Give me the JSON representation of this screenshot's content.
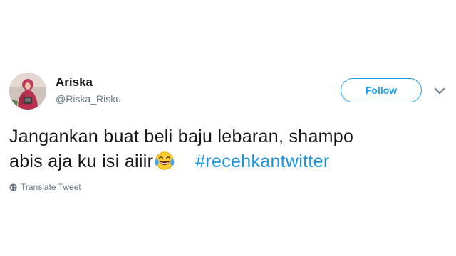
{
  "user": {
    "display_name": "Ariska",
    "handle": "@Riska_Risku",
    "avatar_icon": "profile-photo"
  },
  "actions": {
    "follow_label": "Follow",
    "menu_icon": "chevron-down-icon"
  },
  "tweet": {
    "line1": "Jangankan buat beli baju lebaran, shampo",
    "line2": "abis aja ku isi aiiir",
    "emoji": "face-with-tears-of-joy",
    "hashtag": "#recehkantwitter"
  },
  "footer": {
    "translate_label": "Translate Tweet",
    "translate_icon": "globe-icon"
  },
  "colors": {
    "accent": "#1da1f2",
    "hashtag": "#1b95e0",
    "text": "#14171a",
    "secondary": "#657786"
  }
}
